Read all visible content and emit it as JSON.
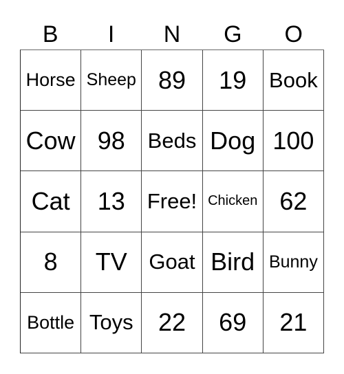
{
  "header": [
    "B",
    "I",
    "N",
    "G",
    "O"
  ],
  "rows": [
    [
      "Horse",
      "Sheep",
      "89",
      "19",
      "Book"
    ],
    [
      "Cow",
      "98",
      "Beds",
      "Dog",
      "100"
    ],
    [
      "Cat",
      "13",
      "Free!",
      "Chicken",
      "62"
    ],
    [
      "8",
      "TV",
      "Goat",
      "Bird",
      "Bunny"
    ],
    [
      "Bottle",
      "Toys",
      "22",
      "69",
      "21"
    ]
  ]
}
